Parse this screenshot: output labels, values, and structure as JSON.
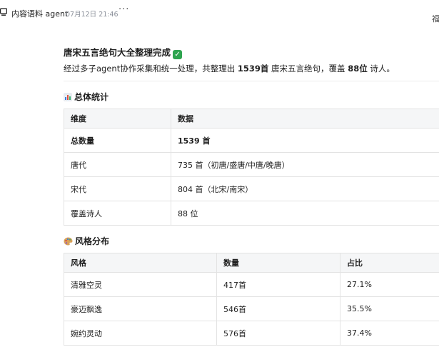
{
  "header": {
    "bot_name": "内容语料 agent",
    "time": "07月12日 21:46",
    "more": "···",
    "edge_glyph": "福"
  },
  "message": {
    "title": "唐宋五言绝句大全整理完成",
    "summary_prefix": "经过多子agent协作采集和统一处理，共整理出 ",
    "summary_count": "1539首",
    "summary_mid": " 唐宋五言绝句，覆盖 ",
    "summary_poets": "88位",
    "summary_suffix": " 诗人。"
  },
  "overall": {
    "title": "总体统计",
    "icon": "bar-chart-icon",
    "headers": [
      "维度",
      "数据"
    ],
    "rows": [
      [
        "总数量",
        "1539 首"
      ],
      [
        "唐代",
        "735 首（初唐/盛唐/中唐/晚唐）"
      ],
      [
        "宋代",
        "804 首（北宋/南宋）"
      ],
      [
        "覆盖诗人",
        "88 位"
      ]
    ]
  },
  "style": {
    "title": "风格分布",
    "icon": "palette-icon",
    "headers": [
      "风格",
      "数量",
      "占比"
    ],
    "rows": [
      [
        "清雅空灵",
        "417首",
        "27.1%"
      ],
      [
        "豪迈飘逸",
        "546首",
        "35.5%"
      ],
      [
        "婉约灵动",
        "576首",
        "37.4%"
      ]
    ]
  },
  "colors": {
    "check": "#2ea44f",
    "table_header_bg": "#f5f6f7",
    "border": "#e3e3e3"
  }
}
